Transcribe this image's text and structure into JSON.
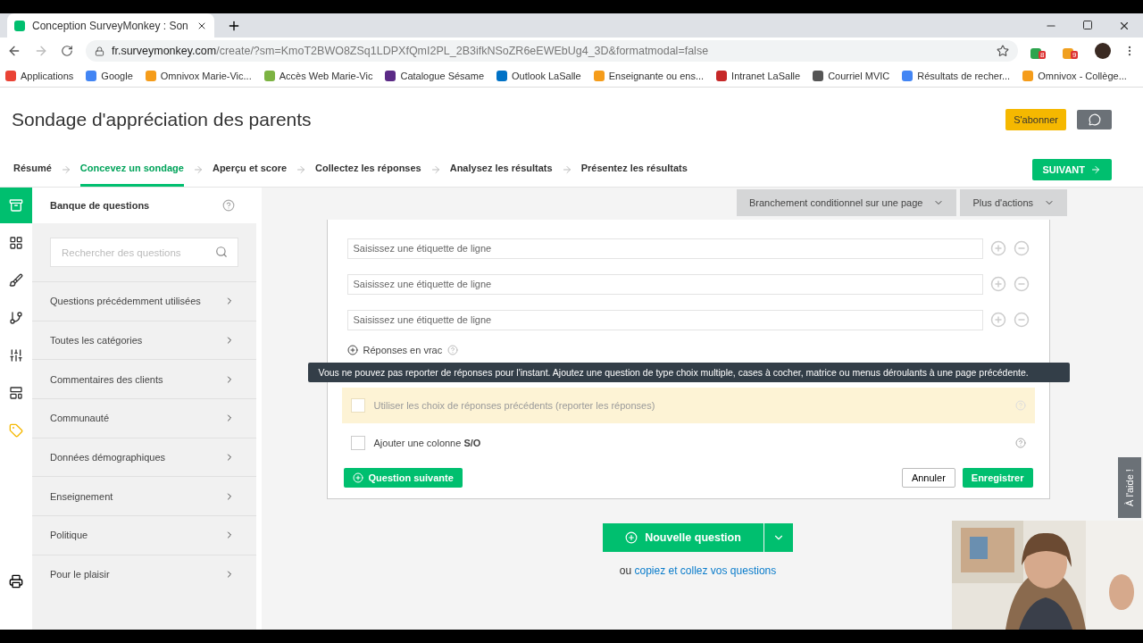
{
  "browser": {
    "tab_title": "Conception SurveyMonkey : Son",
    "url_host": "fr.surveymonkey.com",
    "url_path": "/create/?sm=KmoT2BWO8ZSq1LDPXfQmI2PL_2B3ifkNSoZR6eEWEbUg4_3D&formatmodal=false",
    "extension_badges": [
      "8",
      "9"
    ],
    "bookmarks": [
      "Applications",
      "Google",
      "Omnivox Marie-Vic...",
      "Accès Web Marie-Vic",
      "Catalogue Sésame",
      "Outlook LaSalle",
      "Enseignante ou ens...",
      "Intranet LaSalle",
      "Courriel MVIC",
      "Résultats de recher...",
      "Omnivox - Collège..."
    ]
  },
  "page": {
    "title": "Sondage d'appréciation des parents",
    "subscribe": "S'abonner"
  },
  "steps": [
    {
      "label": "Résumé",
      "selected": false
    },
    {
      "label": "Concevez un sondage",
      "selected": true
    },
    {
      "label": "Aperçu et score",
      "selected": false
    },
    {
      "label": "Collectez les réponses",
      "selected": false
    },
    {
      "label": "Analysez les résultats",
      "selected": false
    },
    {
      "label": "Présentez les résultats",
      "selected": false
    }
  ],
  "next_button": "SUIVANT",
  "side_icons": [
    {
      "kind": "bank",
      "selected": true
    },
    {
      "kind": "grid",
      "selected": false
    },
    {
      "kind": "brush",
      "selected": false
    },
    {
      "kind": "logic",
      "selected": false
    },
    {
      "kind": "sliders",
      "selected": false
    },
    {
      "kind": "layout",
      "selected": false
    },
    {
      "kind": "tag",
      "selected": false
    }
  ],
  "question_bank": {
    "title": "Banque de questions",
    "search_placeholder": "Rechercher des questions",
    "items": [
      "Questions précédemment utilisées",
      "Toutes les catégories",
      "Commentaires des clients",
      "Communauté",
      "Données démographiques",
      "Enseignement",
      "Politique",
      "Pour le plaisir"
    ]
  },
  "toolbar": [
    "Branchement conditionnel sur une page",
    "Plus d'actions"
  ],
  "editor": {
    "row_placeholders": [
      "Saisissez une étiquette de ligne",
      "Saisissez une étiquette de ligne",
      "Saisissez une étiquette de ligne"
    ],
    "bulk_link": "Réponses en vrac",
    "tooltip": "Vous ne pouvez pas reporter de réponses pour l'instant. Ajoutez une question de type choix multiple, cases à cocher, matrice ou menus déroulants à une page précédente.",
    "options": [
      {
        "label": "Utiliser les choix de réponses précédents (reporter les réponses)",
        "checked": false,
        "disabled": true
      },
      {
        "label": "Ajouter une colonne **S/O**",
        "checked": false,
        "disabled": false
      }
    ],
    "next_question": "Question suivante",
    "cancel": "Annuler",
    "save": "Enregistrer"
  },
  "new_question": "Nouvelle question",
  "copy_prefix": "ou",
  "copy_link": "copiez et collez vos questions",
  "help_tab": "À l'aide !",
  "webcam": {
    "kind": "picture"
  }
}
